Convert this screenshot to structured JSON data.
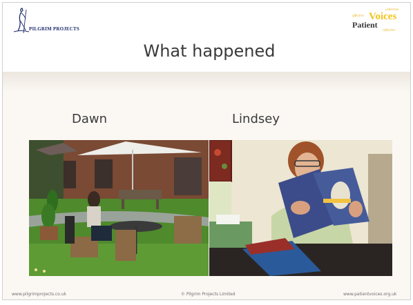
{
  "logos": {
    "pilgrim": {
      "text": "PILGRIM PROJECTS",
      "icon": "pilgrim-figure-icon"
    },
    "patient_voices": {
      "affective": "affective",
      "collective": "collective",
      "voices": "Voices",
      "patient": "Patient",
      "reflective": "reflective"
    }
  },
  "slide": {
    "title": "What happened",
    "people": [
      {
        "name": "Dawn"
      },
      {
        "name": "Lindsey"
      }
    ]
  },
  "footer": {
    "left": "www.pilgrimprojects.co.uk",
    "center": "© Pilgrim Projects Limited",
    "right": "www.patientvoices.org.uk"
  },
  "colors": {
    "title_text": "#3a3a3a",
    "pilgrim_blue": "#1d2a6b",
    "voices_gold": "#f0c419"
  }
}
